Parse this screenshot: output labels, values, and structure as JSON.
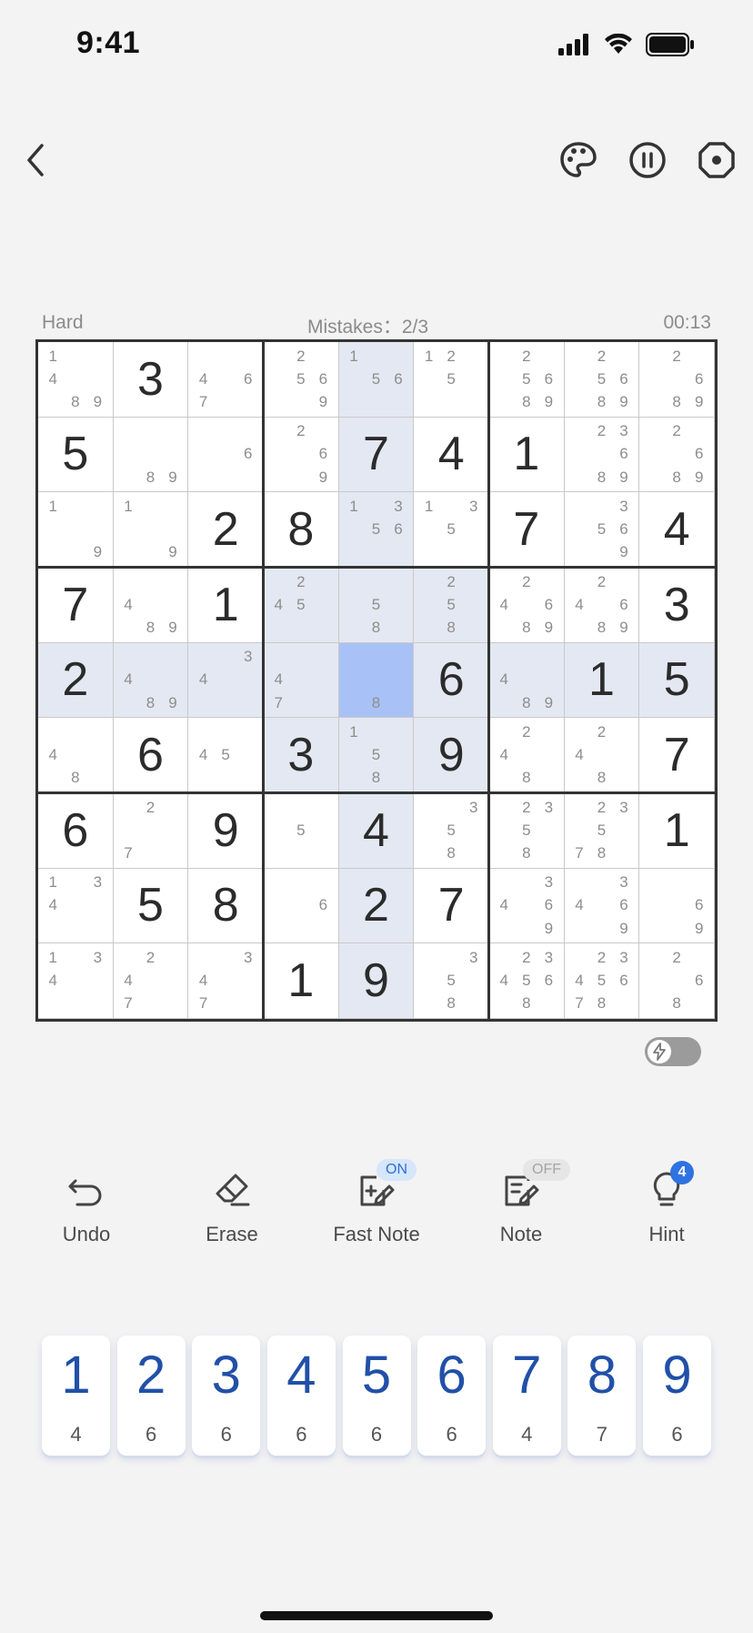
{
  "status": {
    "time": "9:41"
  },
  "info": {
    "difficulty": "Hard",
    "mistakes": "Mistakes：2/3",
    "timer": "00:13"
  },
  "board": {
    "selected": [
      4,
      4
    ],
    "highlighted": [
      [
        0,
        4
      ],
      [
        1,
        4
      ],
      [
        2,
        4
      ],
      [
        3,
        3
      ],
      [
        3,
        4
      ],
      [
        3,
        5
      ],
      [
        4,
        0
      ],
      [
        4,
        1
      ],
      [
        4,
        2
      ],
      [
        4,
        3
      ],
      [
        4,
        5
      ],
      [
        4,
        6
      ],
      [
        4,
        7
      ],
      [
        4,
        8
      ],
      [
        5,
        3
      ],
      [
        5,
        4
      ],
      [
        5,
        5
      ],
      [
        6,
        4
      ],
      [
        7,
        4
      ],
      [
        8,
        4
      ]
    ],
    "rows": [
      [
        {
          "n": [
            1,
            4,
            8,
            9
          ]
        },
        {
          "v": "3"
        },
        {
          "n": [
            4,
            6,
            7
          ]
        },
        {
          "n": [
            2,
            5,
            6,
            9
          ]
        },
        {
          "n": [
            1,
            5,
            6
          ]
        },
        {
          "n": [
            1,
            2,
            5
          ]
        },
        {
          "n": [
            2,
            5,
            6,
            8,
            9
          ]
        },
        {
          "n": [
            2,
            5,
            6,
            8,
            9
          ]
        },
        {
          "n": [
            2,
            6,
            8,
            9
          ]
        }
      ],
      [
        {
          "v": "5"
        },
        {
          "n": [
            8,
            9
          ]
        },
        {
          "n": [
            6
          ]
        },
        {
          "n": [
            2,
            6,
            9
          ]
        },
        {
          "v": "7"
        },
        {
          "v": "4"
        },
        {
          "v": "1"
        },
        {
          "n": [
            2,
            3,
            6,
            8,
            9
          ]
        },
        {
          "n": [
            2,
            6,
            8,
            9
          ]
        }
      ],
      [
        {
          "n": [
            1,
            9
          ]
        },
        {
          "n": [
            1,
            9
          ]
        },
        {
          "v": "2"
        },
        {
          "v": "8"
        },
        {
          "n": [
            1,
            3,
            5,
            6
          ]
        },
        {
          "n": [
            1,
            3,
            5
          ]
        },
        {
          "v": "7"
        },
        {
          "n": [
            3,
            5,
            6,
            9
          ]
        },
        {
          "v": "4"
        }
      ],
      [
        {
          "v": "7"
        },
        {
          "n": [
            4,
            8,
            9
          ]
        },
        {
          "v": "1"
        },
        {
          "n": [
            2,
            4,
            5
          ]
        },
        {
          "n": [
            5,
            8
          ]
        },
        {
          "n": [
            2,
            5,
            8
          ]
        },
        {
          "n": [
            2,
            4,
            6,
            8,
            9
          ]
        },
        {
          "n": [
            2,
            4,
            6,
            8,
            9
          ]
        },
        {
          "v": "3"
        }
      ],
      [
        {
          "v": "2"
        },
        {
          "n": [
            4,
            8,
            9
          ]
        },
        {
          "n": [
            3,
            4
          ]
        },
        {
          "n": [
            4,
            7
          ]
        },
        {
          "n": [
            8
          ]
        },
        {
          "v": "6"
        },
        {
          "n": [
            4,
            8,
            9
          ]
        },
        {
          "v": "1"
        },
        {
          "v": "5"
        }
      ],
      [
        {
          "n": [
            4,
            8
          ]
        },
        {
          "v": "6"
        },
        {
          "n": [
            4,
            5
          ]
        },
        {
          "v": "3"
        },
        {
          "n": [
            1,
            5,
            8
          ]
        },
        {
          "v": "9"
        },
        {
          "n": [
            2,
            4,
            8
          ]
        },
        {
          "n": [
            2,
            4,
            8
          ]
        },
        {
          "v": "7"
        }
      ],
      [
        {
          "v": "6"
        },
        {
          "n": [
            2,
            7
          ]
        },
        {
          "v": "9"
        },
        {
          "n": [
            5
          ]
        },
        {
          "v": "4"
        },
        {
          "n": [
            3,
            5,
            8
          ]
        },
        {
          "n": [
            2,
            3,
            5,
            8
          ]
        },
        {
          "n": [
            2,
            3,
            5,
            7,
            8
          ]
        },
        {
          "v": "1"
        }
      ],
      [
        {
          "n": [
            1,
            3,
            4
          ]
        },
        {
          "v": "5"
        },
        {
          "v": "8"
        },
        {
          "n": [
            6
          ]
        },
        {
          "v": "2"
        },
        {
          "v": "7"
        },
        {
          "n": [
            3,
            4,
            6,
            9
          ]
        },
        {
          "n": [
            3,
            4,
            6,
            9
          ]
        },
        {
          "n": [
            6,
            9
          ]
        }
      ],
      [
        {
          "n": [
            1,
            3,
            4
          ]
        },
        {
          "n": [
            2,
            4,
            7
          ]
        },
        {
          "n": [
            3,
            4,
            7
          ]
        },
        {
          "v": "1"
        },
        {
          "v": "9"
        },
        {
          "n": [
            3,
            5,
            8
          ]
        },
        {
          "n": [
            2,
            3,
            4,
            5,
            6,
            8
          ]
        },
        {
          "n": [
            2,
            3,
            4,
            5,
            6,
            7,
            8
          ]
        },
        {
          "n": [
            2,
            6,
            8
          ]
        }
      ]
    ]
  },
  "tools": {
    "undo": "Undo",
    "erase": "Erase",
    "fast_note": "Fast Note",
    "fast_note_state": "ON",
    "note": "Note",
    "note_state": "OFF",
    "hint": "Hint",
    "hint_count": "4"
  },
  "numpad": [
    {
      "digit": "1",
      "count": "4"
    },
    {
      "digit": "2",
      "count": "6"
    },
    {
      "digit": "3",
      "count": "6"
    },
    {
      "digit": "4",
      "count": "6"
    },
    {
      "digit": "5",
      "count": "6"
    },
    {
      "digit": "6",
      "count": "6"
    },
    {
      "digit": "7",
      "count": "4"
    },
    {
      "digit": "8",
      "count": "7"
    },
    {
      "digit": "9",
      "count": "6"
    }
  ],
  "colors": {
    "accent": "#2f73e0",
    "highlight": "#e4e8f2",
    "selected": "#a8c2f7",
    "digit_blue": "#2150a8"
  },
  "icons": [
    "back-icon",
    "palette-icon",
    "pause-icon",
    "settings-icon",
    "undo-icon",
    "eraser-icon",
    "fast-note-icon",
    "note-icon",
    "hint-bulb-icon",
    "bolt-icon"
  ]
}
